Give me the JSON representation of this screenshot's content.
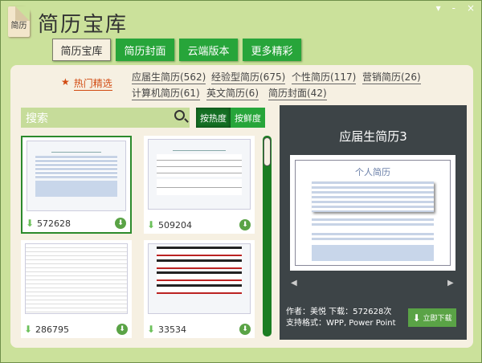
{
  "app": {
    "logo_text": "简历",
    "title": "简历宝库",
    "controls": [
      "▾",
      "-",
      "×"
    ]
  },
  "tabs": [
    {
      "label": "简历宝库"
    },
    {
      "label": "简历封面"
    },
    {
      "label": "云端版本"
    },
    {
      "label": "更多精彩"
    }
  ],
  "hot": {
    "icon": "★",
    "label": "热门精选"
  },
  "categories": [
    {
      "label": "应届生简历(562)"
    },
    {
      "label": "经验型简历(675)"
    },
    {
      "label": "个性简历(117)"
    },
    {
      "label": "营销简历(26)"
    },
    {
      "label": "计算机简历(61)"
    },
    {
      "label": "英文简历(6)"
    },
    {
      "label": "简历封面(42)"
    }
  ],
  "search": {
    "placeholder": "搜索"
  },
  "sort": [
    {
      "label": "按热度"
    },
    {
      "label": "按鲜度"
    }
  ],
  "cards": [
    {
      "downloads": "572628"
    },
    {
      "downloads": "509204"
    },
    {
      "downloads": "286795"
    },
    {
      "downloads": "33534"
    }
  ],
  "detail": {
    "title": "应届生简历3",
    "preview_heading": "个人简历",
    "author": "作者：美悦 下载：572628次",
    "formats": "支持格式：WPP, Power Point",
    "download_label": "立即下载"
  }
}
